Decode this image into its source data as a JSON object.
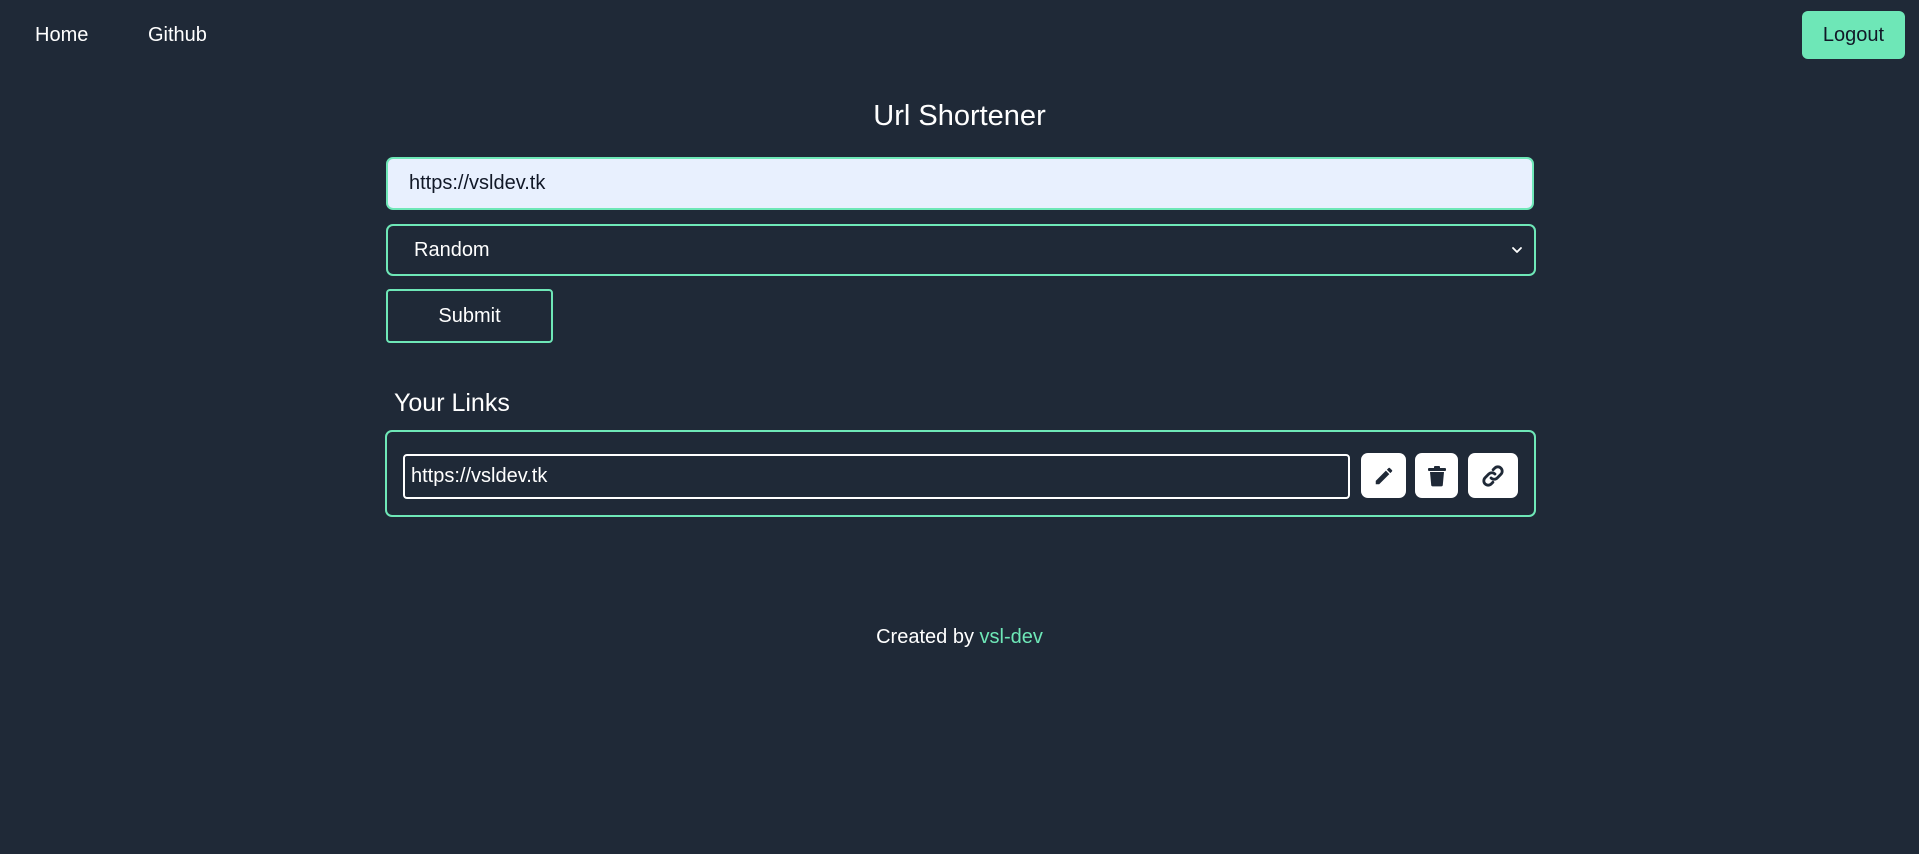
{
  "nav": {
    "home_label": "Home",
    "github_label": "Github",
    "logout_label": "Logout"
  },
  "form": {
    "title": "Url Shortener",
    "url_value": "https://vsldev.tk",
    "mode_selected": "Random",
    "submit_label": "Submit"
  },
  "links": {
    "heading": "Your Links",
    "items": [
      {
        "url": "https://vsldev.tk",
        "actions": [
          "pencil-icon",
          "trash-icon",
          "link-icon"
        ]
      }
    ]
  },
  "footer": {
    "prefix": "Created by",
    "author": "vsl-dev"
  },
  "colors": {
    "background": "#1f2937",
    "accent": "#6ee7b7",
    "input_fill": "#e8f0fe",
    "text": "#ffffff",
    "icon": "#1f2937"
  }
}
